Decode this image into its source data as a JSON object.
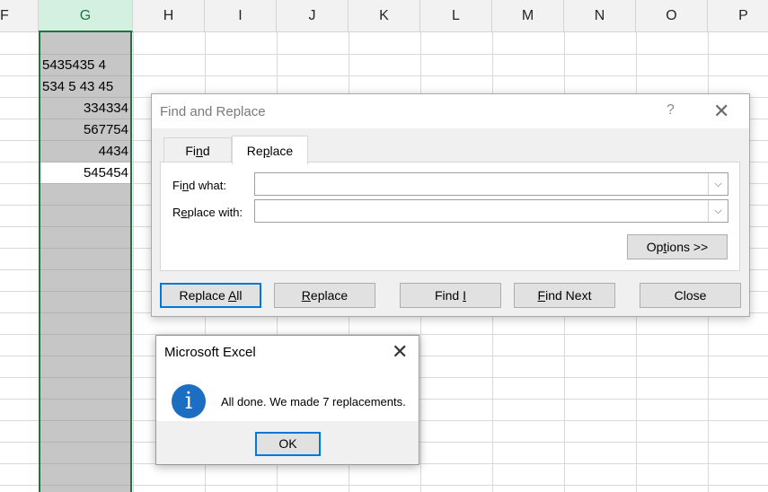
{
  "sheet": {
    "columns": [
      "F",
      "G",
      "H",
      "I",
      "J",
      "K",
      "L",
      "M",
      "N",
      "O",
      "P"
    ],
    "selected_column": "G",
    "g_cells": [
      {
        "value": "",
        "align": "left"
      },
      {
        "value": "5435435 4",
        "align": "left"
      },
      {
        "value": "534 5 43 45",
        "align": "left"
      },
      {
        "value": "334334",
        "align": "right"
      },
      {
        "value": "567754",
        "align": "right"
      },
      {
        "value": "4434",
        "align": "right"
      },
      {
        "value": "545454",
        "align": "right"
      }
    ],
    "selection_color": "#217346"
  },
  "find_replace": {
    "title": "Find and Replace",
    "help_icon": "?",
    "close_icon": "✕",
    "tabs": [
      {
        "label_pre": "Fi",
        "label_ul": "n",
        "label_post": "d"
      },
      {
        "label_pre": "Re",
        "label_ul": "p",
        "label_post": "lace"
      }
    ],
    "find_label": {
      "pre": "Fi",
      "ul": "n",
      "post": "d what:"
    },
    "replace_label": {
      "pre": "R",
      "ul": "e",
      "post": "place with:"
    },
    "find_value": "",
    "replace_value": "",
    "options_button": {
      "pre": "Op",
      "ul": "t",
      "post": "ions >>"
    },
    "buttons": {
      "replace_all": {
        "pre": "Replace ",
        "ul": "A",
        "post": "ll"
      },
      "replace": {
        "pre": "",
        "ul": "R",
        "post": "eplace"
      },
      "find_all": {
        "pre": "Find ",
        "ul": "I",
        "post": ""
      },
      "find_next": {
        "pre": "",
        "ul": "F",
        "post": "ind Next"
      },
      "close": "Close"
    }
  },
  "message_box": {
    "title": "Microsoft Excel",
    "close_icon": "✕",
    "icon": "info-icon",
    "icon_glyph": "i",
    "message": "All done. We made 7 replacements.",
    "ok_label": "OK"
  }
}
